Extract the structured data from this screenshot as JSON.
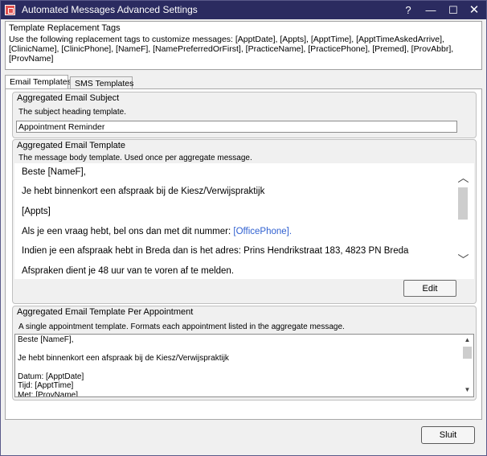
{
  "window": {
    "title": "Automated Messages Advanced Settings",
    "controls": {
      "help": "?",
      "minimize": "—",
      "maximize": "☐",
      "close": "✕"
    }
  },
  "tags": {
    "title": "Template Replacement Tags",
    "description": "Use the following replacement tags to customize messages: [ApptDate], [Appts], [ApptTime], [ApptTimeAskedArrive], [ClinicName], [ClinicPhone], [NameF], [NamePreferredOrFirst], [PracticeName], [PracticePhone], [Premed], [ProvAbbr], [ProvName]"
  },
  "tabs": [
    {
      "label": "Email Templates",
      "active": true
    },
    {
      "label": "SMS Templates",
      "active": false
    }
  ],
  "subject": {
    "title": "Aggregated Email Subject",
    "description": "The subject heading template.",
    "value": "Appointment Reminder"
  },
  "email_template": {
    "title": "Aggregated Email Template",
    "description": "The message body template. Used once per aggregate message.",
    "lines": [
      "Beste [NameF],",
      "Je hebt binnenkort een afspraak bij de Kiesz/Verwijspraktijk",
      "[Appts]",
      "Als je een vraag hebt, bel ons dan met dit nummer: ",
      "Indien je een afspraak hebt in Breda dan is het adres: Prins Hendrikstraat 183, 4823 PN Breda",
      "Afspraken dient je 48 uur van te voren af te melden."
    ],
    "phone_tag": "[OfficePhone].",
    "edit_label": "Edit"
  },
  "appt_template": {
    "title": "Aggregated Email Template Per Appointment",
    "description": "A single appointment template. Formats each appointment listed in the aggregate message.",
    "lines": [
      "Beste [NameF],",
      "Je hebt binnenkort een afspraak bij de Kiesz/Verwijspraktijk",
      "Datum: [ApptDate]",
      "Tijd: [ApptTime]",
      "Met: [ProvName]"
    ]
  },
  "footer": {
    "close_label": "Sluit"
  },
  "icons": {
    "scroll_up": "▲",
    "scroll_down": "▼",
    "chevron_up": "︿",
    "chevron_down": "﹀"
  },
  "colors": {
    "titlebar": "#2b2b60",
    "tag_link": "#3060d0"
  }
}
